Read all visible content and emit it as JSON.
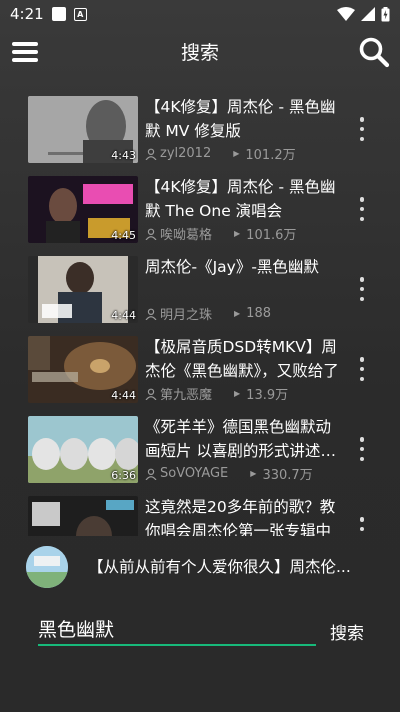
{
  "status_bar": {
    "time": "4:21",
    "icons": [
      "notification-square-icon",
      "text-a-icon",
      "wifi-icon",
      "signal-icon",
      "battery-charging-icon"
    ]
  },
  "header": {
    "title": "搜索",
    "menu_icon": "menu-icon",
    "search_icon": "search-icon"
  },
  "videos": [
    {
      "title": "【4K修复】周杰伦 - 黑色幽默 MV 修复版",
      "author": "zyl2012",
      "views": "101.2万",
      "duration": "4:43"
    },
    {
      "title": "【4K修复】周杰伦 - 黑色幽默 The One 演唱会",
      "author": "唉呦葛格",
      "views": "101.6万",
      "duration": "4:45"
    },
    {
      "title": "周杰伦-《Jay》-黑色幽默",
      "author": "明月之珠",
      "views": "188",
      "duration": "4:44"
    },
    {
      "title": "【极屌音质DSD转MKV】周杰伦《黑色幽默》，又败给了",
      "author": "第九恶魔",
      "views": "13.9万",
      "duration": "4:44"
    },
    {
      "title": "《死羊羊》德国黑色幽默动画短片 以喜剧的形式讲述人性",
      "author": "SoVOYAGE",
      "views": "330.7万",
      "duration": "6:36"
    },
    {
      "title": "这竟然是20多年前的歌？教你唱会周杰伦第一张专辑中",
      "author": "",
      "views": "",
      "duration": ""
    }
  ],
  "now_playing": {
    "title": "【从前从前有个人爱你很久】周杰伦..."
  },
  "search": {
    "value": "黑色幽默",
    "button_label": "搜索"
  },
  "colors": {
    "background": "#2f2f2f",
    "accent_underline": "#17b97a",
    "meta_text": "#9a9a9a"
  }
}
